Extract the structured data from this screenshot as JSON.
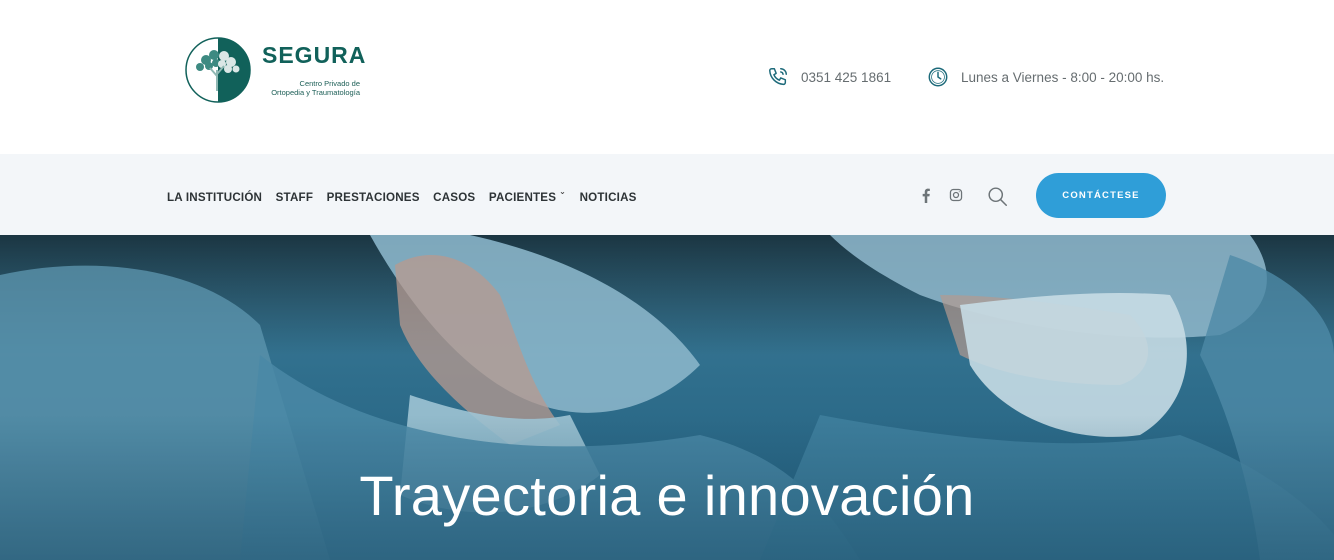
{
  "brand": {
    "name": "SEGURA",
    "subtitle_line1": "Centro Privado de",
    "subtitle_line2": "Ortopedia y Traumatología",
    "color": "#11615a"
  },
  "contact": {
    "phone": "0351 425 1861",
    "phone_icon": "phone-icon",
    "hours": "Lunes a Viernes - 8:00 - 20:00 hs.",
    "hours_icon": "clock-icon"
  },
  "nav": {
    "items": [
      {
        "label": "LA INSTITUCIÓN"
      },
      {
        "label": "STAFF"
      },
      {
        "label": "PRESTACIONES"
      },
      {
        "label": "CASOS"
      },
      {
        "label": "PACIENTES",
        "has_dropdown": true
      },
      {
        "label": "NOTICIAS"
      }
    ],
    "social": [
      "facebook-icon",
      "instagram-icon"
    ],
    "search_icon": "search-icon",
    "cta_label": "CONTÁCTESE",
    "cta_color": "#2f9ed8"
  },
  "hero": {
    "title": "Trayectoria e innovación"
  }
}
